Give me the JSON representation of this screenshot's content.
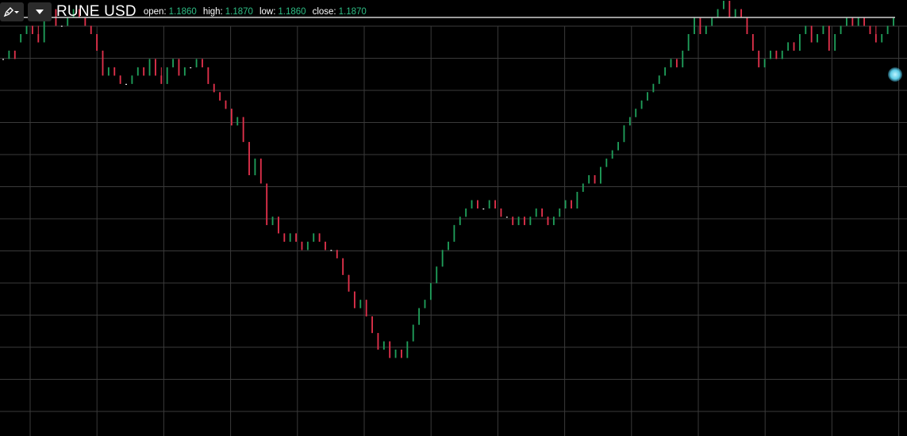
{
  "toolbar": {
    "draw_tool_icon": "pen-with-dropdown-icon",
    "menu_icon": "caret-down-icon",
    "symbol": "RUNE USD",
    "ohlc": {
      "open_label": "open:",
      "open": "1.1860",
      "high_label": "high:",
      "high": "1.1870",
      "low_label": "low:",
      "low": "1.1860",
      "close_label": "close:",
      "close": "1.1870"
    }
  },
  "colors": {
    "background": "#000000",
    "grid": "#3a3a3a",
    "up": "#1f9e5a",
    "down": "#e0314b",
    "flat": "#ffffff",
    "value_green": "#2ebd85",
    "crosshair": "#d0d0d0",
    "cursor_dot": "#5ccbe6"
  },
  "chart_data": {
    "type": "candlestick",
    "symbol": "RUNE USD",
    "grid": true,
    "price_range": [
      0.935,
      1.1975
    ],
    "crosshair_price": 1.187,
    "tick_size": 0.005,
    "candles": [
      [
        1.162,
        1.162,
        1.162,
        1.162
      ],
      [
        1.162,
        1.167,
        1.162,
        1.167
      ],
      [
        1.167,
        1.167,
        1.162,
        1.162
      ],
      [
        1.172,
        1.177,
        1.172,
        1.177
      ],
      [
        1.177,
        1.182,
        1.177,
        1.182
      ],
      [
        1.182,
        1.182,
        1.177,
        1.177
      ],
      [
        1.177,
        1.182,
        1.172,
        1.172
      ],
      [
        1.172,
        1.187,
        1.172,
        1.187
      ],
      [
        1.187,
        1.192,
        1.187,
        1.192
      ],
      [
        1.192,
        1.192,
        1.182,
        1.182
      ],
      [
        1.182,
        1.182,
        1.182,
        1.182
      ],
      [
        1.182,
        1.187,
        1.182,
        1.187
      ],
      [
        1.187,
        1.192,
        1.187,
        1.192
      ],
      [
        1.192,
        1.192,
        1.187,
        1.187
      ],
      [
        1.187,
        1.187,
        1.182,
        1.182
      ],
      [
        1.182,
        1.182,
        1.177,
        1.177
      ],
      [
        1.177,
        1.177,
        1.167,
        1.167
      ],
      [
        1.167,
        1.167,
        1.152,
        1.152
      ],
      [
        1.152,
        1.157,
        1.152,
        1.157
      ],
      [
        1.157,
        1.157,
        1.152,
        1.152
      ],
      [
        1.152,
        1.152,
        1.147,
        1.147
      ],
      [
        1.147,
        1.147,
        1.147,
        1.147
      ],
      [
        1.147,
        1.152,
        1.147,
        1.152
      ],
      [
        1.152,
        1.157,
        1.152,
        1.157
      ],
      [
        1.157,
        1.157,
        1.152,
        1.152
      ],
      [
        1.152,
        1.162,
        1.152,
        1.162
      ],
      [
        1.162,
        1.162,
        1.152,
        1.152
      ],
      [
        1.152,
        1.157,
        1.147,
        1.147
      ],
      [
        1.147,
        1.157,
        1.147,
        1.157
      ],
      [
        1.157,
        1.162,
        1.157,
        1.162
      ],
      [
        1.162,
        1.162,
        1.152,
        1.152
      ],
      [
        1.152,
        1.157,
        1.152,
        1.157
      ],
      [
        1.157,
        1.157,
        1.157,
        1.157
      ],
      [
        1.157,
        1.162,
        1.157,
        1.162
      ],
      [
        1.162,
        1.162,
        1.157,
        1.157
      ],
      [
        1.157,
        1.157,
        1.147,
        1.147
      ],
      [
        1.147,
        1.147,
        1.142,
        1.142
      ],
      [
        1.142,
        1.142,
        1.137,
        1.137
      ],
      [
        1.137,
        1.137,
        1.132,
        1.132
      ],
      [
        1.132,
        1.132,
        1.122,
        1.122
      ],
      [
        1.122,
        1.127,
        1.122,
        1.127
      ],
      [
        1.127,
        1.127,
        1.112,
        1.112
      ],
      [
        1.112,
        1.112,
        1.092,
        1.092
      ],
      [
        1.092,
        1.102,
        1.092,
        1.102
      ],
      [
        1.102,
        1.102,
        1.087,
        1.087
      ],
      [
        1.087,
        1.087,
        1.062,
        1.062
      ],
      [
        1.062,
        1.067,
        1.062,
        1.067
      ],
      [
        1.067,
        1.067,
        1.057,
        1.057
      ],
      [
        1.057,
        1.057,
        1.052,
        1.052
      ],
      [
        1.052,
        1.057,
        1.052,
        1.057
      ],
      [
        1.057,
        1.057,
        1.052,
        1.052
      ],
      [
        1.052,
        1.052,
        1.047,
        1.047
      ],
      [
        1.047,
        1.052,
        1.047,
        1.052
      ],
      [
        1.052,
        1.057,
        1.052,
        1.057
      ],
      [
        1.057,
        1.057,
        1.052,
        1.052
      ],
      [
        1.052,
        1.052,
        1.047,
        1.047
      ],
      [
        1.047,
        1.047,
        1.047,
        1.047
      ],
      [
        1.047,
        1.047,
        1.042,
        1.042
      ],
      [
        1.042,
        1.042,
        1.032,
        1.032
      ],
      [
        1.032,
        1.032,
        1.022,
        1.022
      ],
      [
        1.022,
        1.022,
        1.012,
        1.012
      ],
      [
        1.012,
        1.017,
        1.012,
        1.017
      ],
      [
        1.017,
        1.017,
        1.007,
        1.007
      ],
      [
        1.007,
        1.007,
        0.997,
        0.997
      ],
      [
        0.997,
        0.997,
        0.987,
        0.987
      ],
      [
        0.987,
        0.992,
        0.987,
        0.992
      ],
      [
        0.992,
        0.992,
        0.982,
        0.982
      ],
      [
        0.982,
        0.987,
        0.982,
        0.987
      ],
      [
        0.987,
        0.987,
        0.982,
        0.982
      ],
      [
        0.982,
        0.992,
        0.982,
        0.992
      ],
      [
        0.992,
        1.002,
        0.992,
        1.002
      ],
      [
        1.002,
        1.012,
        1.002,
        1.012
      ],
      [
        1.012,
        1.017,
        1.012,
        1.017
      ],
      [
        1.017,
        1.027,
        1.017,
        1.027
      ],
      [
        1.027,
        1.037,
        1.027,
        1.037
      ],
      [
        1.037,
        1.047,
        1.037,
        1.047
      ],
      [
        1.047,
        1.052,
        1.047,
        1.052
      ],
      [
        1.052,
        1.062,
        1.052,
        1.062
      ],
      [
        1.062,
        1.067,
        1.062,
        1.067
      ],
      [
        1.067,
        1.072,
        1.067,
        1.072
      ],
      [
        1.072,
        1.077,
        1.072,
        1.077
      ],
      [
        1.077,
        1.077,
        1.072,
        1.072
      ],
      [
        1.072,
        1.072,
        1.072,
        1.072
      ],
      [
        1.072,
        1.077,
        1.072,
        1.077
      ],
      [
        1.077,
        1.077,
        1.072,
        1.072
      ],
      [
        1.072,
        1.072,
        1.067,
        1.067
      ],
      [
        1.067,
        1.067,
        1.067,
        1.067
      ],
      [
        1.067,
        1.067,
        1.062,
        1.062
      ],
      [
        1.062,
        1.067,
        1.062,
        1.067
      ],
      [
        1.067,
        1.067,
        1.062,
        1.062
      ],
      [
        1.062,
        1.067,
        1.062,
        1.067
      ],
      [
        1.067,
        1.072,
        1.067,
        1.072
      ],
      [
        1.072,
        1.072,
        1.067,
        1.067
      ],
      [
        1.067,
        1.067,
        1.062,
        1.062
      ],
      [
        1.062,
        1.067,
        1.062,
        1.067
      ],
      [
        1.067,
        1.072,
        1.067,
        1.072
      ],
      [
        1.072,
        1.077,
        1.072,
        1.077
      ],
      [
        1.077,
        1.077,
        1.072,
        1.072
      ],
      [
        1.072,
        1.082,
        1.072,
        1.082
      ],
      [
        1.082,
        1.087,
        1.082,
        1.087
      ],
      [
        1.087,
        1.092,
        1.087,
        1.092
      ],
      [
        1.092,
        1.092,
        1.087,
        1.087
      ],
      [
        1.087,
        1.097,
        1.087,
        1.097
      ],
      [
        1.097,
        1.102,
        1.097,
        1.102
      ],
      [
        1.102,
        1.107,
        1.102,
        1.107
      ],
      [
        1.107,
        1.112,
        1.107,
        1.112
      ],
      [
        1.112,
        1.122,
        1.112,
        1.122
      ],
      [
        1.122,
        1.127,
        1.122,
        1.127
      ],
      [
        1.127,
        1.132,
        1.127,
        1.132
      ],
      [
        1.132,
        1.137,
        1.132,
        1.137
      ],
      [
        1.137,
        1.142,
        1.137,
        1.142
      ],
      [
        1.142,
        1.147,
        1.142,
        1.147
      ],
      [
        1.147,
        1.152,
        1.147,
        1.152
      ],
      [
        1.152,
        1.157,
        1.152,
        1.157
      ],
      [
        1.157,
        1.162,
        1.157,
        1.162
      ],
      [
        1.162,
        1.162,
        1.157,
        1.157
      ],
      [
        1.157,
        1.167,
        1.157,
        1.167
      ],
      [
        1.167,
        1.177,
        1.167,
        1.177
      ],
      [
        1.177,
        1.187,
        1.177,
        1.187
      ],
      [
        1.187,
        1.187,
        1.177,
        1.177
      ],
      [
        1.177,
        1.182,
        1.177,
        1.182
      ],
      [
        1.182,
        1.187,
        1.182,
        1.187
      ],
      [
        1.187,
        1.192,
        1.187,
        1.192
      ],
      [
        1.192,
        1.197,
        1.192,
        1.197
      ],
      [
        1.197,
        1.197,
        1.187,
        1.187
      ],
      [
        1.187,
        1.192,
        1.187,
        1.192
      ],
      [
        1.192,
        1.192,
        1.187,
        1.187
      ],
      [
        1.187,
        1.187,
        1.177,
        1.177
      ],
      [
        1.177,
        1.177,
        1.167,
        1.167
      ],
      [
        1.167,
        1.167,
        1.157,
        1.157
      ],
      [
        1.157,
        1.162,
        1.157,
        1.162
      ],
      [
        1.162,
        1.167,
        1.162,
        1.167
      ],
      [
        1.167,
        1.167,
        1.162,
        1.162
      ],
      [
        1.162,
        1.167,
        1.162,
        1.167
      ],
      [
        1.167,
        1.172,
        1.167,
        1.172
      ],
      [
        1.172,
        1.172,
        1.167,
        1.167
      ],
      [
        1.167,
        1.177,
        1.167,
        1.177
      ],
      [
        1.177,
        1.182,
        1.177,
        1.182
      ],
      [
        1.182,
        1.182,
        1.172,
        1.172
      ],
      [
        1.172,
        1.177,
        1.172,
        1.177
      ],
      [
        1.177,
        1.182,
        1.177,
        1.182
      ],
      [
        1.182,
        1.182,
        1.167,
        1.167
      ],
      [
        1.167,
        1.177,
        1.167,
        1.177
      ],
      [
        1.177,
        1.182,
        1.177,
        1.182
      ],
      [
        1.182,
        1.187,
        1.182,
        1.187
      ],
      [
        1.187,
        1.187,
        1.182,
        1.182
      ],
      [
        1.182,
        1.187,
        1.182,
        1.187
      ],
      [
        1.187,
        1.187,
        1.182,
        1.182
      ],
      [
        1.182,
        1.182,
        1.177,
        1.177
      ],
      [
        1.177,
        1.182,
        1.172,
        1.172
      ],
      [
        1.172,
        1.177,
        1.172,
        1.177
      ],
      [
        1.177,
        1.182,
        1.177,
        1.182
      ],
      [
        1.182,
        1.187,
        1.182,
        1.187
      ]
    ]
  }
}
